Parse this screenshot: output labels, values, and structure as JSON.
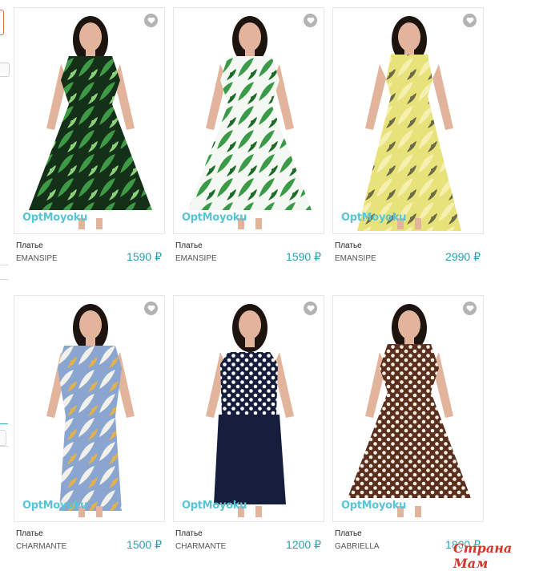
{
  "products": [
    {
      "name": "Платье",
      "brand": "EMANSIPE",
      "price": "1590 ₽",
      "watermark": "OptMoyoku",
      "print": "green-leaf-black",
      "pattern_colors": {
        "base": "#143018",
        "leaf": "#3f9a46",
        "leaf2": "#8dd17a"
      }
    },
    {
      "name": "Платье",
      "brand": "EMANSIPE",
      "price": "1590 ₽",
      "watermark": "OptMoyoku",
      "print": "green-leaf-white",
      "pattern_colors": {
        "base": "#f4f8f2",
        "leaf": "#3a9a48",
        "leaf2": "#1e6a2a"
      }
    },
    {
      "name": "Платье",
      "brand": "EMANSIPE",
      "price": "2990 ₽",
      "watermark": "OptMoyoku",
      "print": "yellow-floral",
      "pattern_colors": {
        "base": "#e8e27a",
        "leaf": "#f5f0b0",
        "leaf2": "#6b6b48"
      }
    },
    {
      "name": "Платье",
      "brand": "CHARMANTE",
      "price": "1500 ₽",
      "watermark": "OptMoyoku",
      "print": "blue-floral",
      "pattern_colors": {
        "base": "#8aa6d0",
        "leaf": "#f1f0ea",
        "leaf2": "#e2b24a"
      }
    },
    {
      "name": "Платье",
      "brand": "CHARMANTE",
      "price": "1200 ₽",
      "watermark": "OptMoyoku",
      "print": "navy-polka-top",
      "pattern_colors": {
        "base": "#171d3c",
        "leaf": "#ffffff",
        "leaf2": "#171d3c"
      }
    },
    {
      "name": "Платье",
      "brand": "GABRIELLA",
      "price": "1800 ₽",
      "watermark": "OptMoyoku",
      "print": "brown-polka",
      "pattern_colors": {
        "base": "#5a2f1d",
        "leaf": "#f6efe6",
        "leaf2": "#5a2f1d"
      }
    }
  ],
  "corner_logo": "Страна Мам",
  "colors": {
    "price": "#27a0b2",
    "favorite_icon_bg": "#b3b3b3",
    "card_border": "#e6e6e6",
    "watermark": "#58c4d6"
  },
  "icons": {
    "favorite": "heart-icon"
  }
}
